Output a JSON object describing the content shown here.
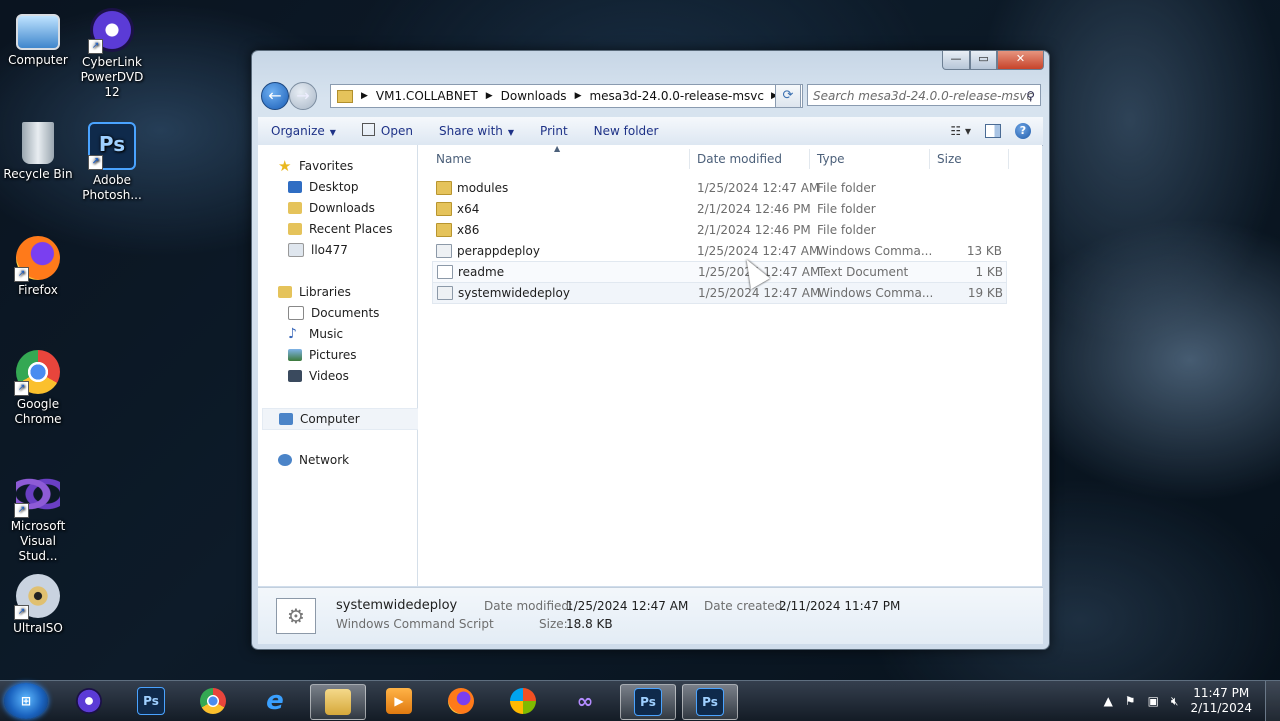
{
  "desktop": {
    "icons": [
      {
        "label": "Computer",
        "icon": "computer-icon"
      },
      {
        "label": "CyberLink PowerDVD 12",
        "icon": "powerdvd-icon"
      },
      {
        "label": "Recycle Bin",
        "icon": "recycle-bin-icon"
      },
      {
        "label": "Adobe Photosh...",
        "icon": "photoshop-icon"
      },
      {
        "label": "Firefox",
        "icon": "firefox-icon"
      },
      {
        "label": "Google Chrome",
        "icon": "chrome-icon"
      },
      {
        "label": "Microsoft Visual Stud...",
        "icon": "visual-studio-icon"
      },
      {
        "label": "UltraISO",
        "icon": "ultraiso-icon"
      }
    ]
  },
  "window": {
    "address": {
      "crumbs": [
        "VM1.COLLABNET",
        "Downloads",
        "mesa3d-24.0.0-release-msvc"
      ]
    },
    "search": {
      "placeholder": "Search mesa3d-24.0.0-release-msvc"
    },
    "toolbar": {
      "organize": "Organize",
      "open": "Open",
      "share_with": "Share with",
      "print": "Print",
      "new_folder": "New folder"
    },
    "nav": {
      "favorites": "Favorites",
      "desktop": "Desktop",
      "downloads": "Downloads",
      "recent_places": "Recent Places",
      "user": "llo477",
      "libraries": "Libraries",
      "documents": "Documents",
      "music": "Music",
      "pictures": "Pictures",
      "videos": "Videos",
      "computer": "Computer",
      "network": "Network"
    },
    "columns": {
      "name": "Name",
      "date_modified": "Date modified",
      "type": "Type",
      "size": "Size"
    },
    "files": [
      {
        "name": "modules",
        "date": "1/25/2024 12:47 AM",
        "type": "File folder",
        "size": "",
        "icon": "folder-icon"
      },
      {
        "name": "x64",
        "date": "2/1/2024 12:46 PM",
        "type": "File folder",
        "size": "",
        "icon": "folder-icon"
      },
      {
        "name": "x86",
        "date": "2/1/2024 12:46 PM",
        "type": "File folder",
        "size": "",
        "icon": "folder-icon"
      },
      {
        "name": "perappdeploy",
        "date": "1/25/2024 12:47 AM",
        "type": "Windows Comma...",
        "size": "13 KB",
        "icon": "script-gear-icon"
      },
      {
        "name": "readme",
        "date": "1/25/2024 12:47 AM",
        "type": "Text Document",
        "size": "1 KB",
        "icon": "text-document-icon"
      },
      {
        "name": "systemwidedeploy",
        "date": "1/25/2024 12:47 AM",
        "type": "Windows Comma...",
        "size": "19 KB",
        "icon": "script-gear-icon"
      }
    ],
    "details": {
      "name": "systemwidedeploy",
      "kind": "Windows Command Script",
      "date_modified_label": "Date modified:",
      "date_modified": "1/25/2024 12:47 AM",
      "date_created_label": "Date created:",
      "date_created": "2/11/2024 11:47 PM",
      "size_label": "Size:",
      "size": "18.8 KB"
    }
  },
  "taskbar": {
    "items": [
      "powerdvd",
      "photoshop",
      "chrome",
      "internet-explorer",
      "windows-explorer",
      "media-player",
      "firefox",
      "windows-logo-app",
      "visual-studio",
      "photoshop",
      "photoshop"
    ],
    "clock": {
      "time": "11:47 PM",
      "date": "2/11/2024"
    }
  },
  "colors": {
    "accent": "#1e3287",
    "selection": "#f0f4f9",
    "close": "#c7432a"
  }
}
